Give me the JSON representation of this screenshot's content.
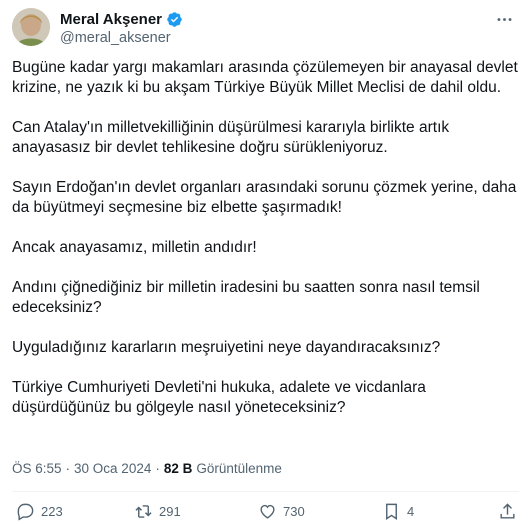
{
  "author": {
    "display_name": "Meral Akşener",
    "handle": "@meral_aksener",
    "avatar_icon": "profile-photo",
    "verified_color": "#1d9bf0"
  },
  "tweet": {
    "paragraphs": [
      "Bugüne kadar yargı makamları arasında çözülemeyen bir anayasal devlet krizine, ne yazık ki bu akşam Türkiye Büyük Millet Meclisi de dahil oldu.",
      "Can Atalay'ın milletvekilliğinin düşürülmesi kararıyla birlikte artık anayasasız bir devlet tehlikesine doğru sürükleniyoruz.",
      "Sayın Erdoğan'ın devlet organları arasındaki sorunu çözmek yerine, daha da büyütmeyi seçmesine biz elbette şaşırmadık!",
      "Ancak anayasamız, milletin andıdır!",
      "Andını çiğnediğiniz bir milletin iradesini bu saatten sonra nasıl temsil edeceksiniz?",
      "Uyguladığınız kararların meşruiyetini neye dayandıracaksınız?",
      "Türkiye Cumhuriyeti Devleti'ni hukuka, adalete ve vicdanlara düşürdüğünüz bu gölgeyle nasıl yöneteceksiniz?"
    ]
  },
  "meta": {
    "time": "ÖS 6:55",
    "separator": "·",
    "date": "30 Oca 2024",
    "views_count": "82 B",
    "views_label": "Görüntülenme"
  },
  "actions": {
    "replies": "223",
    "retweets": "291",
    "likes": "730",
    "bookmarks": "4"
  },
  "icons": {
    "more": "more-icon",
    "reply": "reply-icon",
    "retweet": "retweet-icon",
    "like": "like-icon",
    "bookmark": "bookmark-icon",
    "share": "share-icon"
  }
}
